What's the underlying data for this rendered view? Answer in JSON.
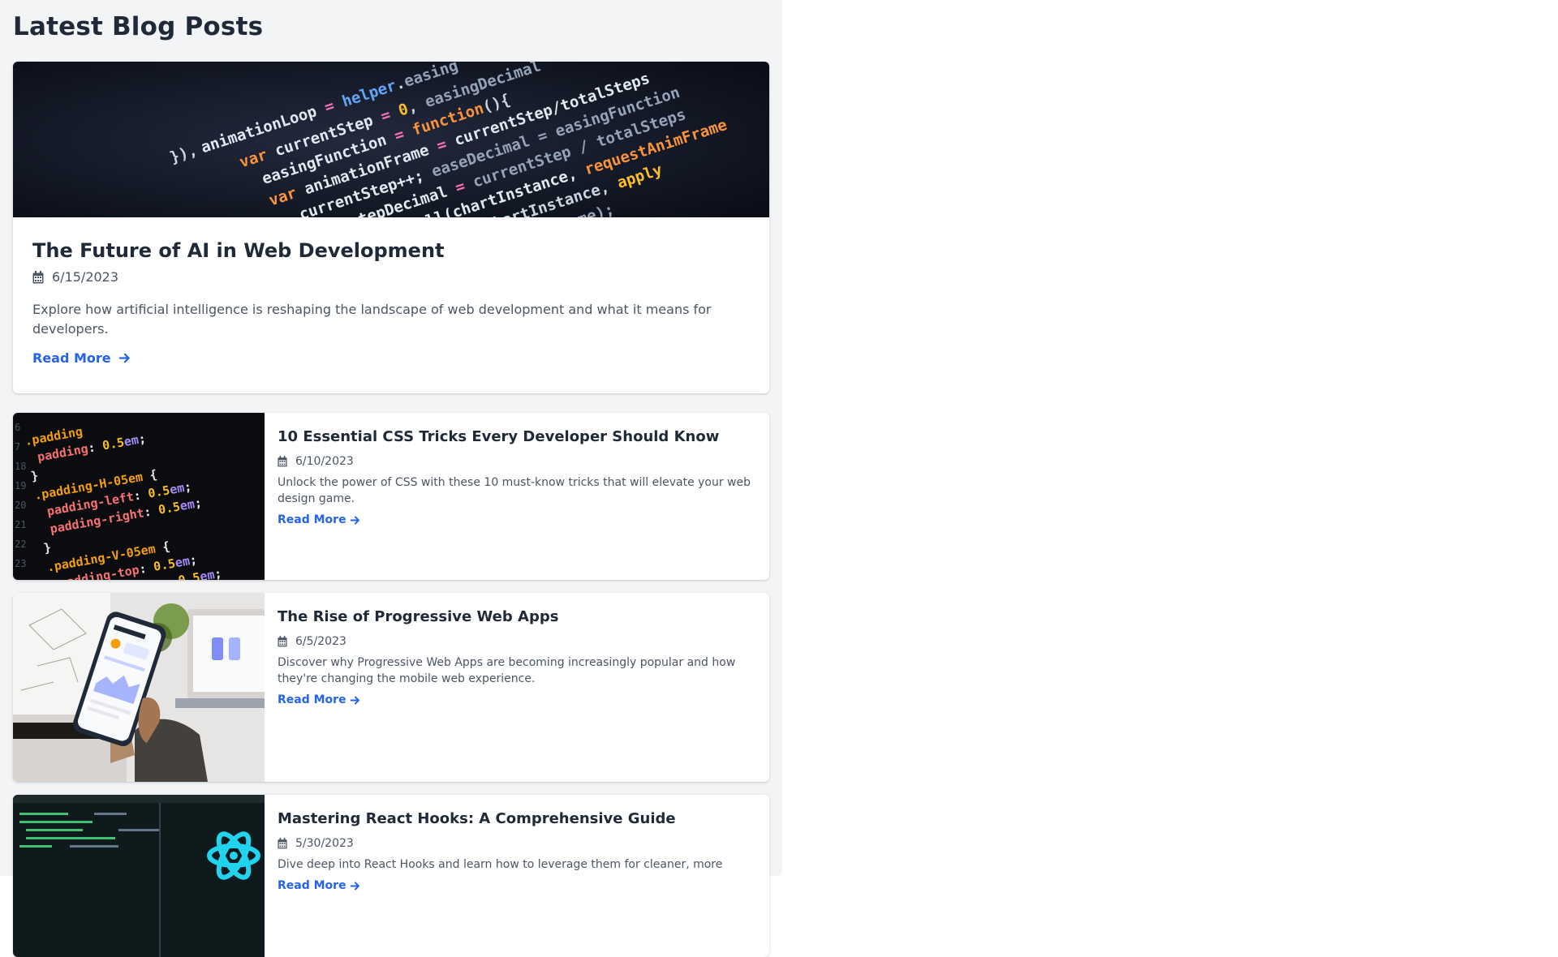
{
  "page": {
    "title": "Latest Blog Posts"
  },
  "colors": {
    "panel_bg": "#f3f4f6",
    "title_text": "#1f2937",
    "body_text": "#4b5563",
    "link": "#2563eb"
  },
  "featured": {
    "image_icon": "code-editor-photo",
    "title": "The Future of AI in Web Development",
    "date": "6/15/2023",
    "excerpt": "Explore how artificial intelligence is reshaping the landscape of web development and what it means for developers.",
    "read_more": "Read More"
  },
  "posts": [
    {
      "image_icon": "css-code-photo",
      "title": "10 Essential CSS Tricks Every Developer Should Know",
      "date": "6/10/2023",
      "excerpt": "Unlock the power of CSS with these 10 must-know tricks that will elevate your web design game.",
      "read_more": "Read More"
    },
    {
      "image_icon": "phone-in-hand-photo",
      "title": "The Rise of Progressive Web Apps",
      "date": "6/5/2023",
      "excerpt": "Discover why Progressive Web Apps are becoming increasingly popular and how they're changing the mobile web experience.",
      "read_more": "Read More"
    },
    {
      "image_icon": "react-logo-photo",
      "title": "Mastering React Hooks: A Comprehensive Guide",
      "date": "5/30/2023",
      "excerpt": "Dive deep into React Hooks and learn how to leverage them for cleaner, more",
      "read_more": "Read More"
    }
  ]
}
